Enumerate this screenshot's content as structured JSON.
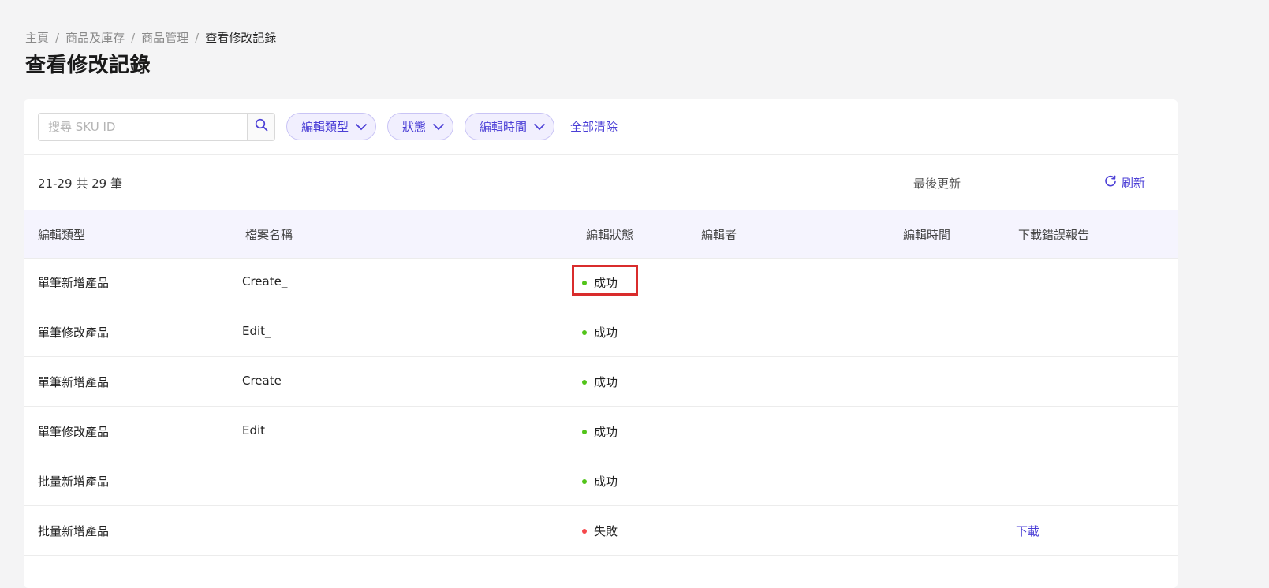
{
  "breadcrumb": {
    "items": [
      "主頁",
      "商品及庫存",
      "商品管理"
    ],
    "current": "查看修改記錄",
    "separator": "/"
  },
  "page_title": "查看修改記錄",
  "filters": {
    "search_placeholder": "搜尋 SKU ID",
    "search_value": "",
    "edit_type_label": "編輯類型",
    "status_label": "狀態",
    "edit_time_label": "編輯時間",
    "clear_all_label": "全部清除"
  },
  "summary": {
    "count_text": "21-29 共 29 筆",
    "last_updated_label": "最後更新",
    "refresh_label": "刷新"
  },
  "table": {
    "columns": [
      "編輯類型",
      "檔案名稱",
      "編輯狀態",
      "編輯者",
      "編輯時間",
      "下載錯誤報告"
    ],
    "rows": [
      {
        "edit_type": "單筆新增產品",
        "file_name": "Create_",
        "status": "成功",
        "download": ""
      },
      {
        "edit_type": "單筆修改產品",
        "file_name": "Edit_",
        "status": "成功",
        "download": ""
      },
      {
        "edit_type": "單筆新增產品",
        "file_name": "Create",
        "status": "成功",
        "download": ""
      },
      {
        "edit_type": "單筆修改產品",
        "file_name": "Edit",
        "status": "成功",
        "download": ""
      },
      {
        "edit_type": "批量新增產品",
        "file_name": "",
        "status": "成功",
        "download": ""
      },
      {
        "edit_type": "批量新增產品",
        "file_name": "",
        "status": "失敗",
        "download": "下載"
      }
    ]
  },
  "colors": {
    "accent": "#4b3fd6",
    "success": "#52c41a",
    "failure": "#f5484b",
    "highlight": "#d92c2c"
  },
  "icons": {
    "search": "search-icon",
    "chevron": "chevron-down-icon",
    "refresh": "refresh-icon"
  }
}
